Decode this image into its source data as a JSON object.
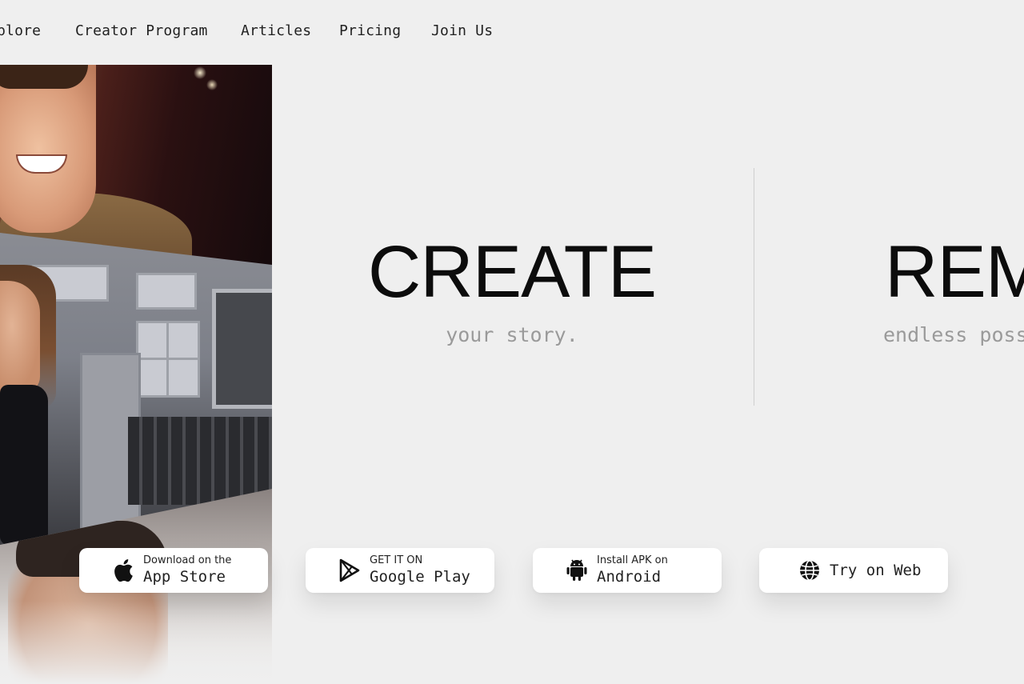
{
  "nav": {
    "items": [
      {
        "label": "plore"
      },
      {
        "label": "Creator Program"
      },
      {
        "label": "Articles"
      },
      {
        "label": "Pricing"
      },
      {
        "label": "Join Us"
      }
    ]
  },
  "hero": {
    "slides": [
      {
        "title": "CREATE",
        "subtitle": "your story."
      },
      {
        "title": "REM",
        "subtitle": "endless poss"
      }
    ]
  },
  "downloads": [
    {
      "small": "Download on the",
      "big": "App Store",
      "icon": "apple-icon"
    },
    {
      "small": "GET IT ON",
      "big": "Google Play",
      "icon": "google-play-icon"
    },
    {
      "small": "Install APK on",
      "big": "Android",
      "icon": "android-icon"
    },
    {
      "label": "Try on Web",
      "icon": "globe-icon"
    }
  ],
  "colors": {
    "background": "#efefef",
    "button_bg": "#ffffff",
    "title": "#0c0c0c",
    "subtitle": "#9a9a9a"
  }
}
